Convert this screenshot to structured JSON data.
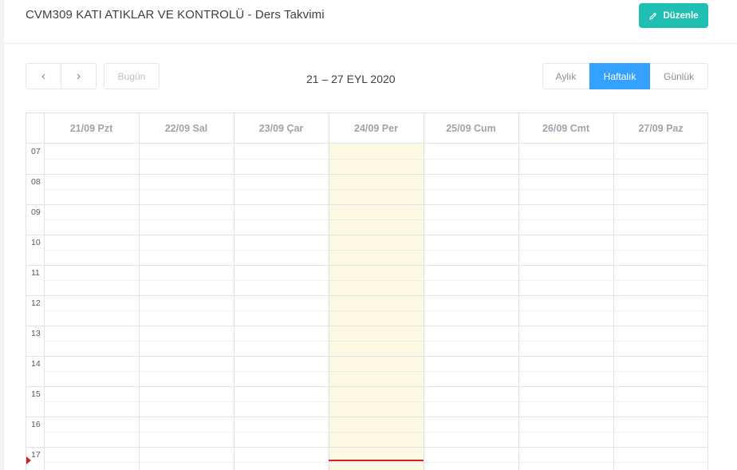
{
  "header": {
    "title": "CVM309 KATI ATIKLAR VE KONTROLÜ - Ders Takvimi",
    "edit_label": "Düzenle"
  },
  "toolbar": {
    "prev_glyph": "‹",
    "next_glyph": "›",
    "today_label": "Bugün",
    "range_title": "21 – 27 EYL 2020",
    "views": {
      "month": "Aylık",
      "week": "Haftalık",
      "day": "Günlük"
    },
    "active_view": "week"
  },
  "calendar": {
    "days": [
      "21/09 Pzt",
      "22/09 Sal",
      "23/09 Çar",
      "24/09 Per",
      "25/09 Cum",
      "26/09 Cmt",
      "27/09 Paz"
    ],
    "today_index": 3,
    "hours": [
      "07",
      "08",
      "09",
      "10",
      "11",
      "12",
      "13",
      "14",
      "15",
      "16",
      "17"
    ]
  },
  "colors": {
    "accent": "#1fbfb2",
    "active_view": "#34a0ff",
    "today_bg": "#fcf8e3",
    "now_indicator": "#d62020"
  }
}
